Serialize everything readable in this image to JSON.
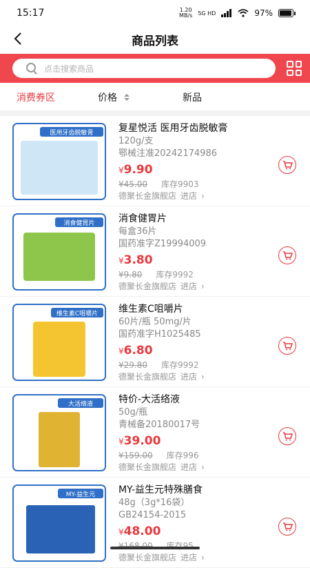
{
  "status_bar": {
    "time": "15:17",
    "net_speed_value": "1.20",
    "net_speed_unit": "MB/s",
    "network": "5G HD",
    "battery": "97%",
    "battery_level": 0.97
  },
  "nav": {
    "title": "商品列表",
    "back_icon": "chevron-left-icon"
  },
  "search": {
    "placeholder": "点击搜索商品",
    "scan_icon": "grid-scan-icon"
  },
  "filters": [
    {
      "label": "消费券区",
      "active": true
    },
    {
      "label": "价格",
      "active": false,
      "icon": "sort-arrows-icon"
    },
    {
      "label": "新品",
      "active": false
    }
  ],
  "colors": {
    "accent": "#e8383d",
    "search_band": "#f0464e",
    "thumb_border": "#2f6fc7"
  },
  "products": [
    {
      "name": "复星悦活 医用牙齿脱敏膏",
      "spec": "120g/支",
      "approval": "鄂械注准20242174986",
      "price": "9.90",
      "original_price": "¥45.00",
      "stock": "库存9903",
      "shop": "德聚长金旗舰店",
      "enter": "进店",
      "thumb_label": "医用牙齿脱敏膏",
      "thumb_color": "#cfe6f7"
    },
    {
      "name": "消食健胃片",
      "spec": "每盒36片",
      "approval": "国药准字Z19994009",
      "price": "3.80",
      "original_price": "¥9.80",
      "stock": "库存9992",
      "shop": "德聚长金旗舰店",
      "enter": "进店",
      "thumb_label": "消食健胃片",
      "thumb_color": "#8ec54b"
    },
    {
      "name": "维生素C咀嚼片",
      "spec": "60片/瓶 50mg/片",
      "approval": "国药准字H1025485",
      "price": "6.80",
      "original_price": "¥29.80",
      "stock": "库存9992",
      "shop": "德聚长金旗舰店",
      "enter": "进店",
      "thumb_label": "维生素C咀嚼片",
      "thumb_color": "#f5c531"
    },
    {
      "name": "特价-大活络液",
      "spec": "50g/瓶",
      "approval": "青械备20180017号",
      "price": "39.00",
      "original_price": "¥159.00",
      "stock": "库存996",
      "shop": "德聚长金旗舰店",
      "enter": "进店",
      "thumb_label": "大活络液",
      "thumb_color": "#e0b332"
    },
    {
      "name": "MY-益生元特殊膳食",
      "spec": "48g（3g*16袋）",
      "approval": "GB24154-2015",
      "price": "48.00",
      "original_price": "¥168.00",
      "stock": "库存95",
      "shop": "德聚长金旗舰店",
      "enter": "进店",
      "thumb_label": "MY-益生元",
      "thumb_color": "#2a63b5"
    }
  ]
}
